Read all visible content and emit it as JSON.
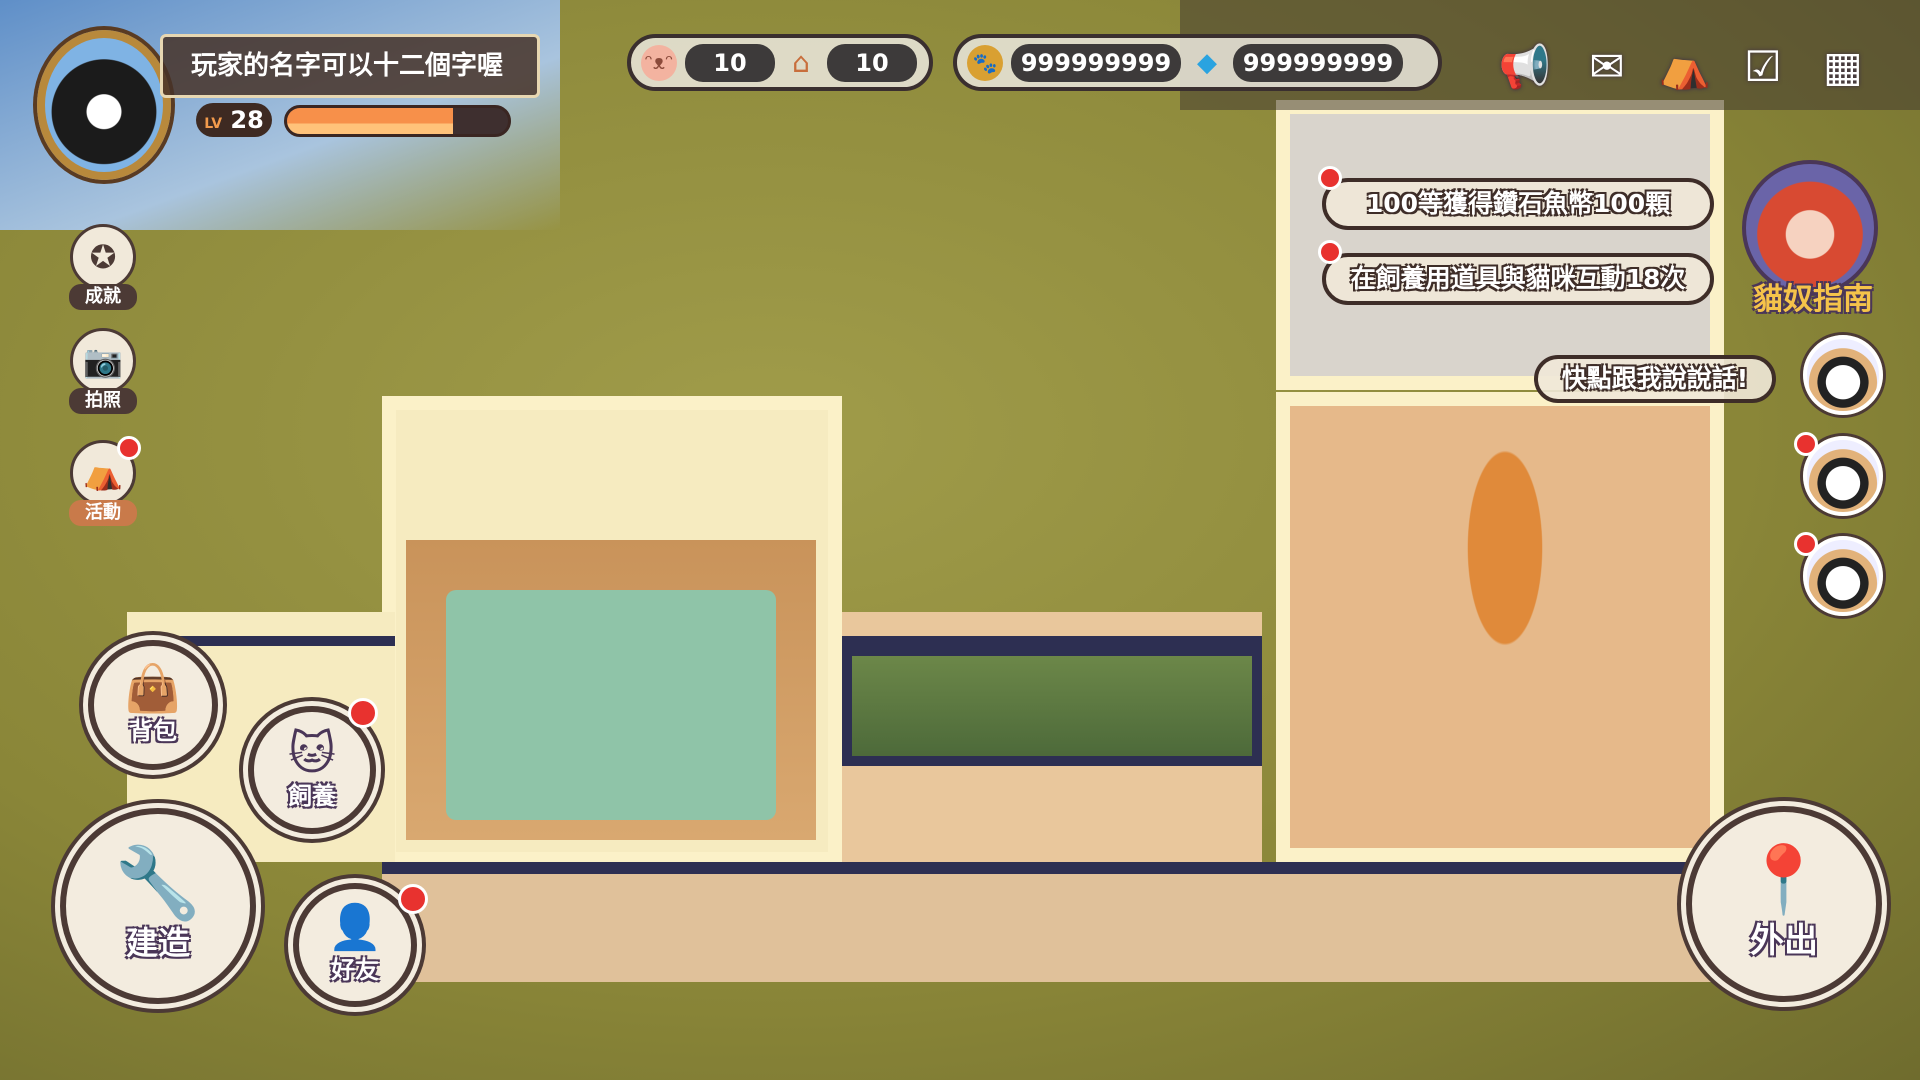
{
  "player": {
    "name": "玩家的名字可以十二個字喔",
    "level_prefix": "LV",
    "level": "28",
    "exp_progress": 0.75
  },
  "counters": [
    {
      "icon": "cat-face-icon",
      "value": "10"
    },
    {
      "icon": "cat-house-icon",
      "value": "10"
    }
  ],
  "currencies": [
    {
      "icon": "paw-coin-icon",
      "value": "999999999"
    },
    {
      "icon": "diamond-fish-icon",
      "value": "999999999"
    }
  ],
  "top_menu": [
    {
      "name": "announcement",
      "icon": "megaphone-icon"
    },
    {
      "name": "mail",
      "icon": "envelope-icon"
    },
    {
      "name": "shop",
      "icon": "store-icon"
    },
    {
      "name": "tasks",
      "icon": "clipboard-check-icon"
    },
    {
      "name": "menu",
      "icon": "grid-icon"
    }
  ],
  "side_menu": [
    {
      "label": "成就",
      "icon": "award-icon"
    },
    {
      "label": "拍照",
      "icon": "camera-icon"
    },
    {
      "label": "活動",
      "icon": "tent-icon",
      "badge": true
    }
  ],
  "quests": [
    "100等獲得鑽石魚幣100顆",
    "在飼養用道具與貓咪互動18次"
  ],
  "guide": {
    "label": "貓奴指南"
  },
  "cat_speech": "快點跟我說說話!",
  "buttons": {
    "bag": "背包",
    "feed": "飼養",
    "build": "建造",
    "friends": "好友",
    "go_out": "外出"
  },
  "colors": {
    "accent": "#f7904a",
    "dark": "#4c3a35",
    "badge": "#e8322f"
  }
}
